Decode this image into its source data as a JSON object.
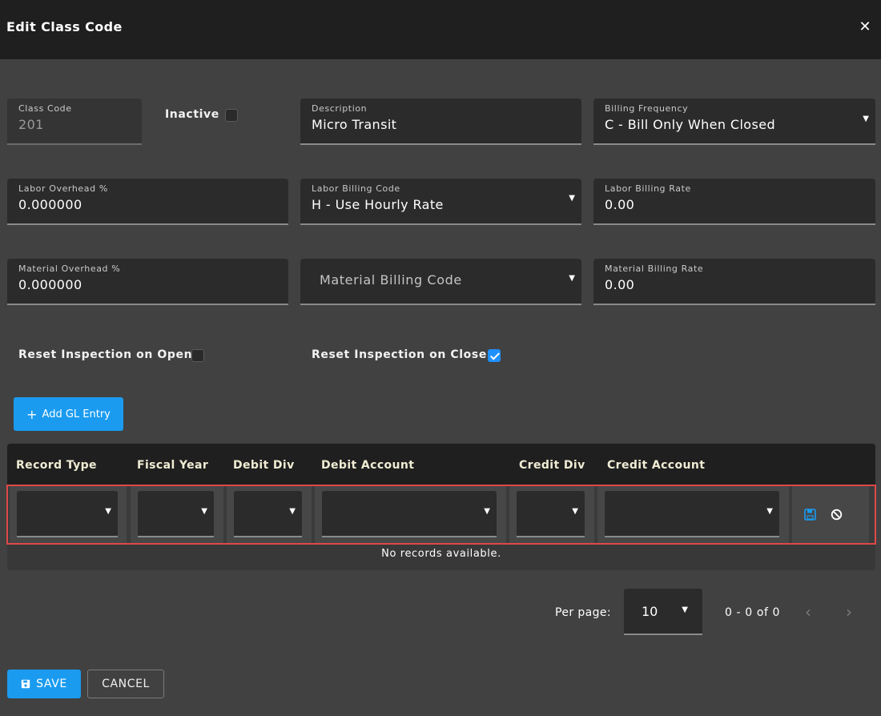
{
  "dialog": {
    "title": "Edit Class Code"
  },
  "form": {
    "class_code": {
      "label": "Class Code",
      "value": "201"
    },
    "inactive": {
      "label": "Inactive",
      "checked": false
    },
    "description": {
      "label": "Description",
      "value": "Micro Transit"
    },
    "billing_frequency": {
      "label": "Billing Frequency",
      "value": "C - Bill Only When Closed"
    },
    "labor_overhead": {
      "label": "Labor Overhead %",
      "value": "0.000000"
    },
    "labor_billing_code": {
      "label": "Labor Billing Code",
      "value": "H - Use Hourly Rate"
    },
    "labor_billing_rate": {
      "label": "Labor Billing Rate",
      "value": "0.00"
    },
    "material_overhead": {
      "label": "Material Overhead %",
      "value": "0.000000"
    },
    "material_billing_code": {
      "placeholder": "Material Billing Code"
    },
    "material_billing_rate": {
      "label": "Material Billing Rate",
      "value": "0.00"
    },
    "reset_on_open": {
      "label": "Reset Inspection on Open",
      "checked": false
    },
    "reset_on_close": {
      "label": "Reset Inspection on Close",
      "checked": true
    }
  },
  "gl": {
    "add_button": "Add GL Entry",
    "columns": [
      "Record Type",
      "Fiscal Year",
      "Debit Div",
      "Debit Account",
      "Credit Div",
      "Credit Account"
    ],
    "empty_text": "No records available."
  },
  "pager": {
    "per_page_label": "Per page:",
    "per_page_value": "10",
    "range": "0 - 0 of 0"
  },
  "actions": {
    "save": "SAVE",
    "cancel": "CANCEL"
  },
  "colors": {
    "accent": "#1a9bf0",
    "highlight_border": "#e04848",
    "background": "#414141"
  },
  "icons": [
    "close-icon",
    "chevron-down-icon",
    "plus-icon",
    "floppy-disk-icon",
    "cancel-circle-icon",
    "chevron-left-icon",
    "chevron-right-icon"
  ]
}
